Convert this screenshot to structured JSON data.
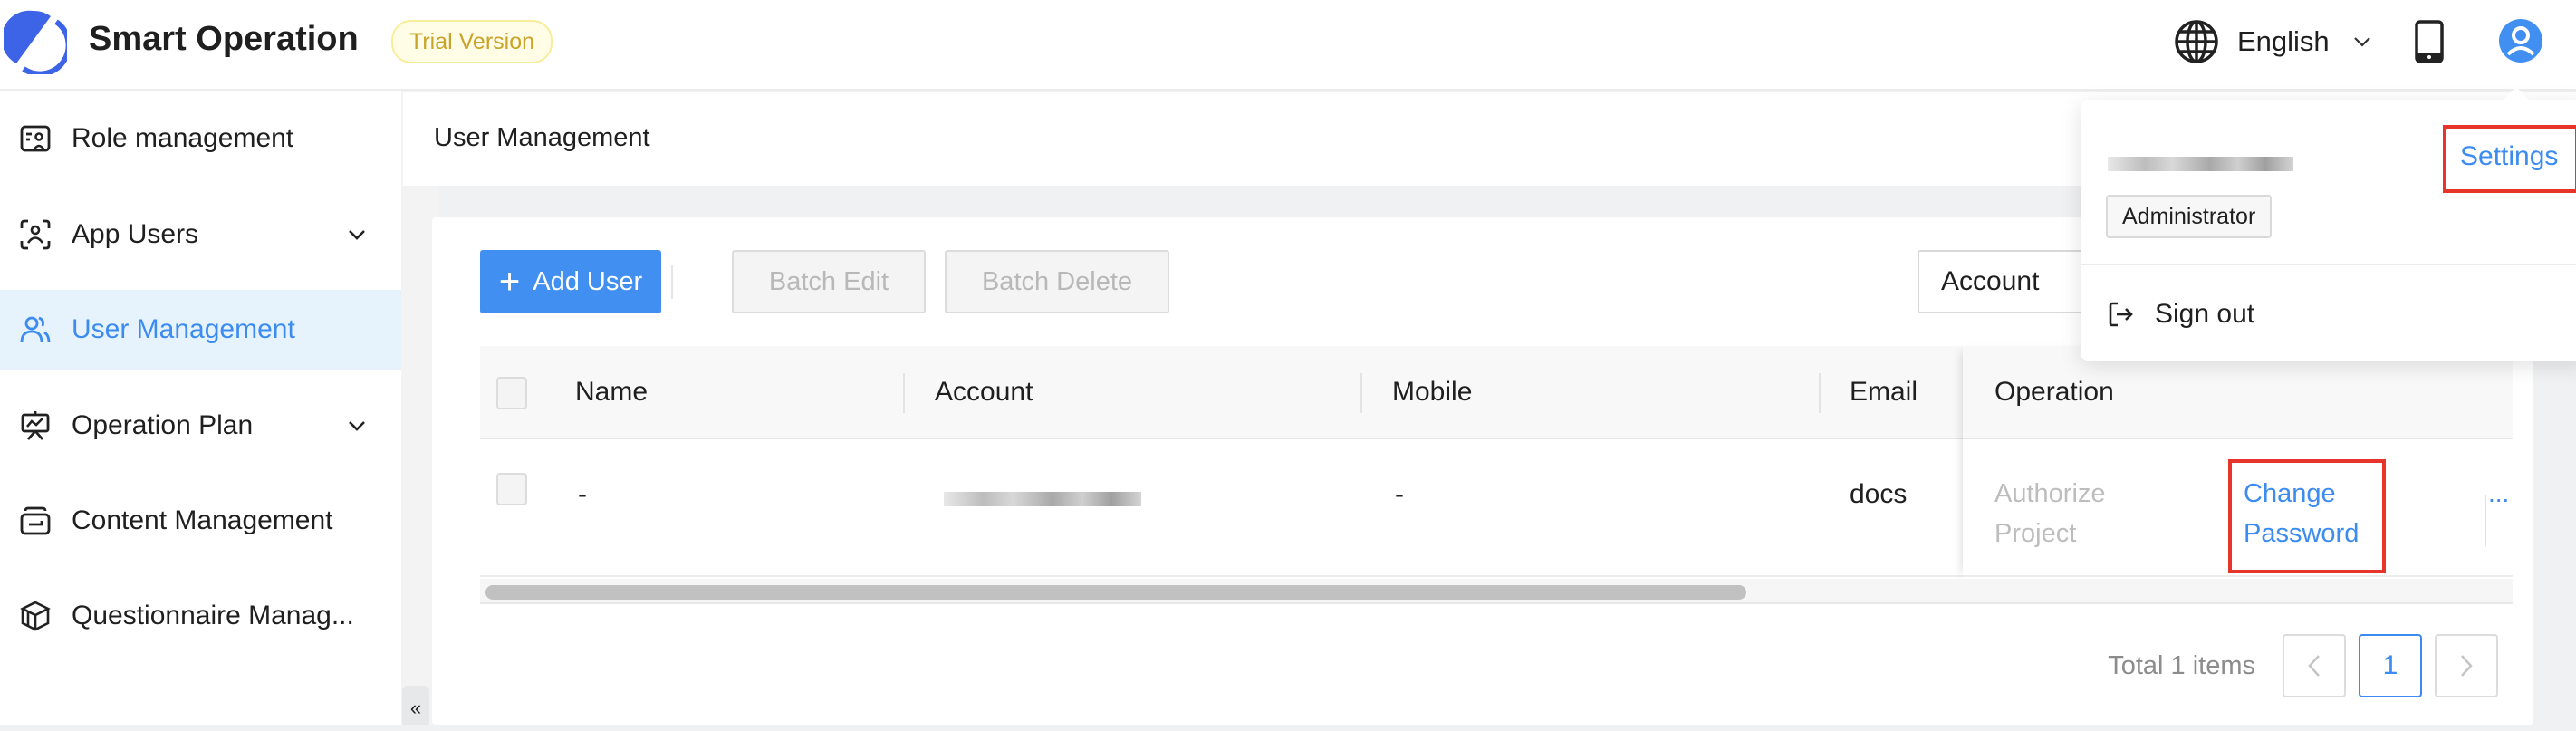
{
  "header": {
    "app_title": "Smart Operation",
    "trial_badge": "Trial Version",
    "language": "English",
    "icons": {
      "logo": "app-logo",
      "language": "globe-icon",
      "language_chevron": "chevron-down-icon",
      "mobile": "mobile-phone-icon",
      "user": "user-avatar-icon"
    }
  },
  "sidebar": {
    "items": [
      {
        "label": "Role management",
        "icon": "role-card-icon",
        "expandable": false,
        "active": false
      },
      {
        "label": "App Users",
        "icon": "face-scan-user-icon",
        "expandable": true,
        "active": false
      },
      {
        "label": "User Management",
        "icon": "users-icon",
        "expandable": false,
        "active": true
      },
      {
        "label": "Operation Plan",
        "icon": "presentation-board-icon",
        "expandable": true,
        "active": false
      },
      {
        "label": "Content Management",
        "icon": "inbox-tray-icon",
        "expandable": false,
        "active": false
      },
      {
        "label": "Questionnaire Manag...",
        "icon": "cube-icon",
        "expandable": false,
        "active": false
      }
    ],
    "collapse_glyph": "«"
  },
  "page": {
    "title": "User Management"
  },
  "toolbar": {
    "add_user": "Add User",
    "batch_edit": "Batch Edit",
    "batch_delete": "Batch Delete",
    "search_field": "Account"
  },
  "table": {
    "columns": [
      "Name",
      "Account",
      "Mobile",
      "Email",
      "Operation"
    ],
    "rows": [
      {
        "name": "-",
        "account": "[redacted]",
        "mobile": "-",
        "email": "docs",
        "operations": {
          "authorize_project": "Authorize Project",
          "change_password": "Change Password",
          "more": "..."
        }
      }
    ]
  },
  "pagination": {
    "total": "Total 1 items",
    "current_page": "1",
    "prev": "<",
    "next": ">"
  },
  "user_menu": {
    "username": "[redacted]",
    "settings": "Settings",
    "role": "Administrator",
    "sign_out": "Sign out"
  },
  "colors": {
    "primary": "#428ff2",
    "link": "#3b8bf0",
    "highlight": "#e8352b",
    "trial_badge_text": "#c9a227",
    "active_nav_bg": "#e6f3fd"
  }
}
